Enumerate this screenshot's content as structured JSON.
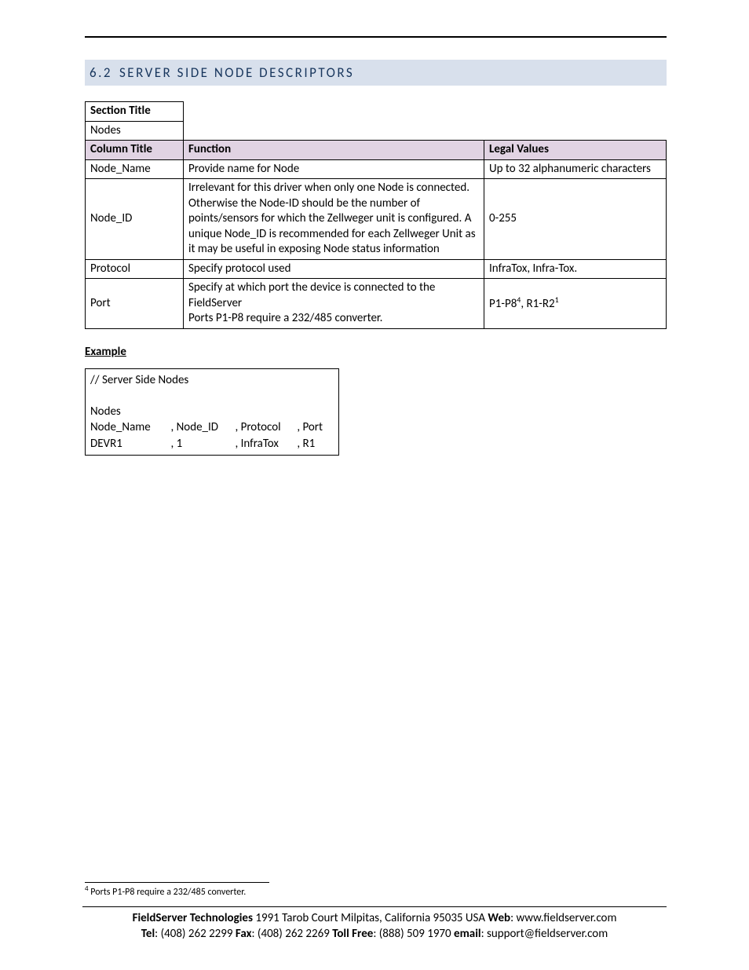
{
  "heading": {
    "number": "6.2",
    "title": "SERVER SIDE NODE DESCRIPTORS"
  },
  "table": {
    "sectionTitleLabel": "Section Title",
    "sectionTitleValue": "Nodes",
    "columnTitleLabel": "Column Title",
    "functionLabel": "Function",
    "legalValuesLabel": "Legal Values",
    "rows": [
      {
        "title": "Node_Name",
        "function": "Provide name for Node",
        "legal": "Up to 32 alphanumeric characters"
      },
      {
        "title": "Node_ID",
        "function": "Irrelevant for this driver when only one Node is connected.  Otherwise the Node-ID should be the number of points/sensors for which the Zellweger unit is configured.  A unique Node_ID is recommended for each Zellweger Unit as it may be useful in exposing Node status information",
        "legal": "0-255"
      },
      {
        "title": "Protocol",
        "function": "Specify protocol used",
        "legal": "InfraTox, Infra-Tox."
      },
      {
        "title": "Port",
        "function": "Specify at which port the device is connected to the FieldServer\nPorts P1-P8 require a 232/485 converter.",
        "legal_prefix": "P1-P8",
        "legal_sup1": "4",
        "legal_mid": ", R1-R2",
        "legal_sup2": "1"
      }
    ]
  },
  "exampleLabel": "Example",
  "example": {
    "comment": "//    Server Side Nodes",
    "section": "Nodes",
    "cols": [
      "Node_Name",
      ", Node_ID",
      ", Protocol",
      ", Port"
    ],
    "vals": [
      "DEVR1",
      ", 1",
      ", InfraTox",
      ", R1"
    ]
  },
  "footnote": {
    "num": "4",
    "text": " Ports P1-P8 require a 232/485 converter."
  },
  "footer": {
    "line1": {
      "company": "FieldServer Technologies",
      "addr": " 1991 Tarob Court Milpitas, California 95035 USA   ",
      "webLabel": "Web",
      "web": ": www.fieldserver.com"
    },
    "line2": {
      "telLabel": "Tel",
      "tel": ": (408) 262 2299   ",
      "faxLabel": "Fax",
      "fax": ": (408) 262 2269   ",
      "tollLabel": "Toll Free",
      "toll": ": (888) 509 1970   ",
      "emailLabel": "email",
      "email": ": support@fieldserver.com"
    }
  }
}
